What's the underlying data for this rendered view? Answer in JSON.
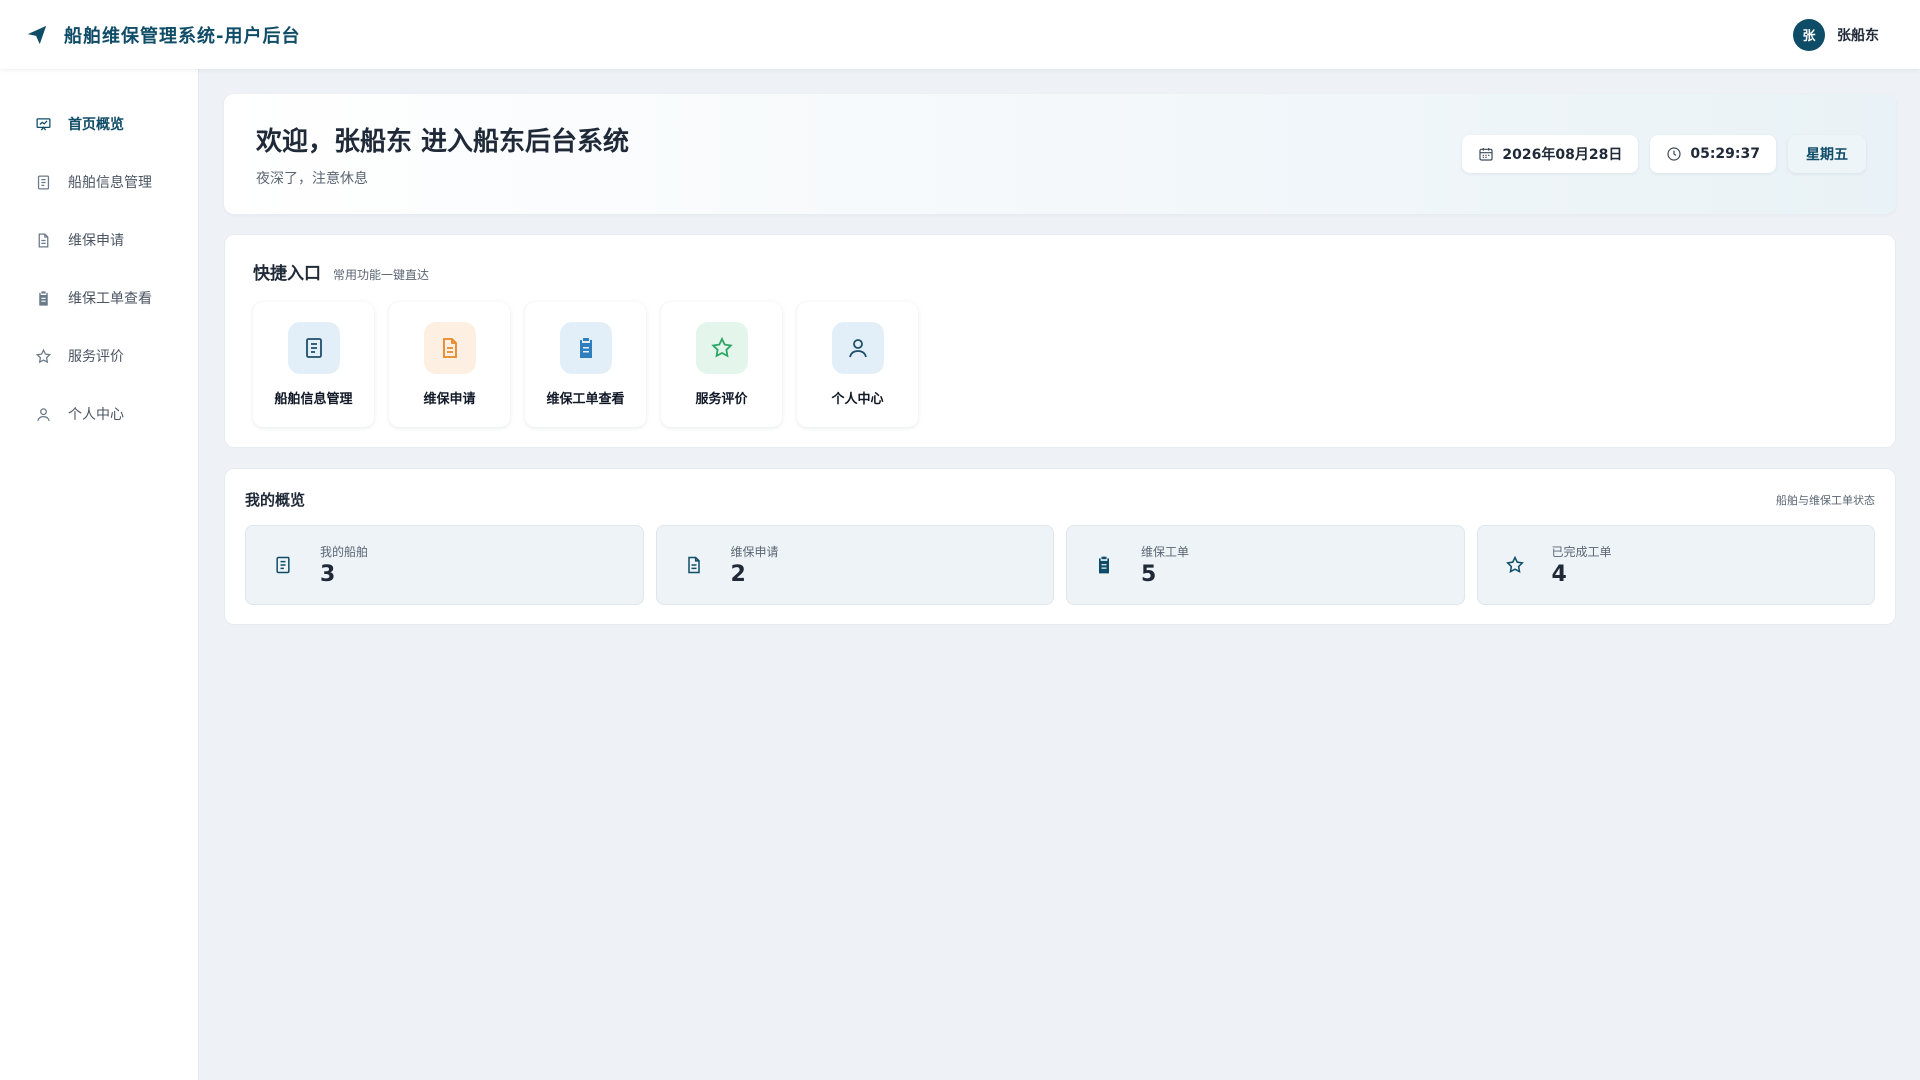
{
  "header": {
    "title": "船舶维保管理系统-用户后台",
    "logo_icon": "send-icon",
    "user": {
      "avatar_initial": "张",
      "name": "张船东"
    }
  },
  "sidebar": {
    "items": [
      {
        "label": "首页概览",
        "icon": "presentation-chart-icon",
        "active": true
      },
      {
        "label": "船舶信息管理",
        "icon": "document-list-icon",
        "active": false
      },
      {
        "label": "维保申请",
        "icon": "file-text-icon",
        "active": false
      },
      {
        "label": "维保工单查看",
        "icon": "clipboard-icon",
        "active": false
      },
      {
        "label": "服务评价",
        "icon": "star-icon",
        "active": false
      },
      {
        "label": "个人中心",
        "icon": "user-icon",
        "active": false
      }
    ]
  },
  "welcome": {
    "title": "欢迎，张船东 进入船东后台系统",
    "subtitle": "夜深了，注意休息",
    "date": "2026年08月28日",
    "time": "05:29:37",
    "weekday": "星期五"
  },
  "quick": {
    "title": "快捷入口",
    "subtitle": "常用功能一键直达",
    "tiles": [
      {
        "label": "船舶信息管理",
        "icon": "document-list-icon",
        "color": "#1f4f6b",
        "bg": "#e3eff8"
      },
      {
        "label": "维保申请",
        "icon": "file-text-icon",
        "color": "#e8862a",
        "bg": "#fdf0e2"
      },
      {
        "label": "维保工单查看",
        "icon": "clipboard-icon",
        "color": "#2f7fbf",
        "bg": "#e3eff8"
      },
      {
        "label": "服务评价",
        "icon": "star-icon",
        "color": "#2ba663",
        "bg": "#e4f5ec"
      },
      {
        "label": "个人中心",
        "icon": "user-icon",
        "color": "#1f4f6b",
        "bg": "#e3eff8"
      }
    ]
  },
  "overview": {
    "title": "我的概览",
    "note": "船舶与维保工单状态",
    "stats": [
      {
        "label": "我的船舶",
        "value": "3",
        "icon": "document-list-icon"
      },
      {
        "label": "维保申请",
        "value": "2",
        "icon": "file-text-icon"
      },
      {
        "label": "维保工单",
        "value": "5",
        "icon": "clipboard-icon"
      },
      {
        "label": "已完成工单",
        "value": "4",
        "icon": "star-icon"
      }
    ]
  },
  "colors": {
    "primary": "#0f4c67",
    "background": "#eef2f6"
  }
}
